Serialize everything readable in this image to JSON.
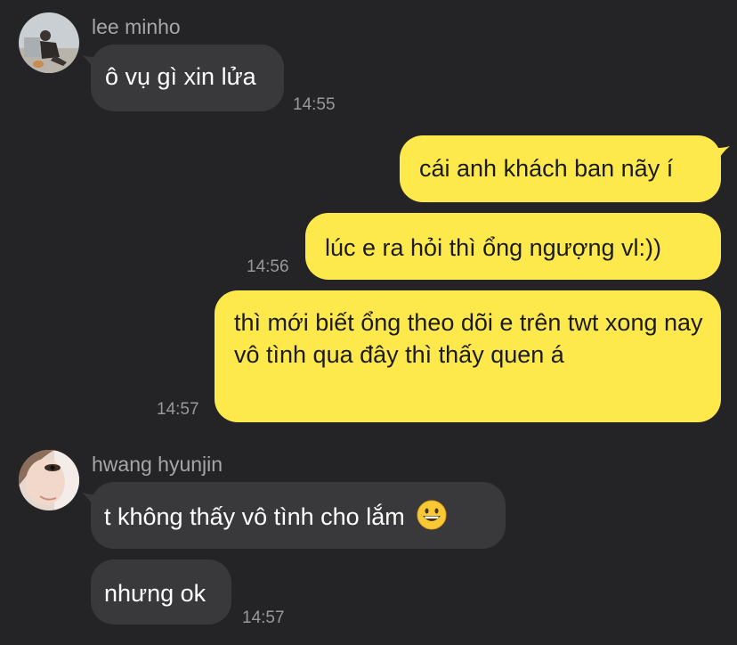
{
  "conversation": {
    "groups": [
      {
        "sender": "lee minho",
        "avatar": "avatar-lee-minho",
        "messages": [
          {
            "text": "ô vụ gì xin lửa",
            "time": "14:55"
          }
        ]
      },
      {
        "sender": "me",
        "messages": [
          {
            "text": "cái anh khách ban nãy í",
            "time": ""
          },
          {
            "text": "lúc e ra hỏi thì ổng ngượng vl:))",
            "time": "14:56"
          },
          {
            "text": "thì mới biết ổng theo dõi e trên twt xong nay vô tình qua đây thì thấy quen á",
            "time": "14:57"
          }
        ]
      },
      {
        "sender": "hwang hyunjin",
        "avatar": "avatar-hwang-hyunjin",
        "messages": [
          {
            "text": "t không thấy vô tình cho lắm",
            "emoji": "grinning-face-emoji",
            "time": ""
          },
          {
            "text": "nhưng ok",
            "time": "14:57"
          }
        ]
      }
    ]
  },
  "colors": {
    "background": "#242426",
    "incoming_bubble": "#39393c",
    "outgoing_bubble": "#fee94d",
    "incoming_text": "#ffffff",
    "outgoing_text": "#1b1b1b",
    "meta_text": "#98989d"
  }
}
